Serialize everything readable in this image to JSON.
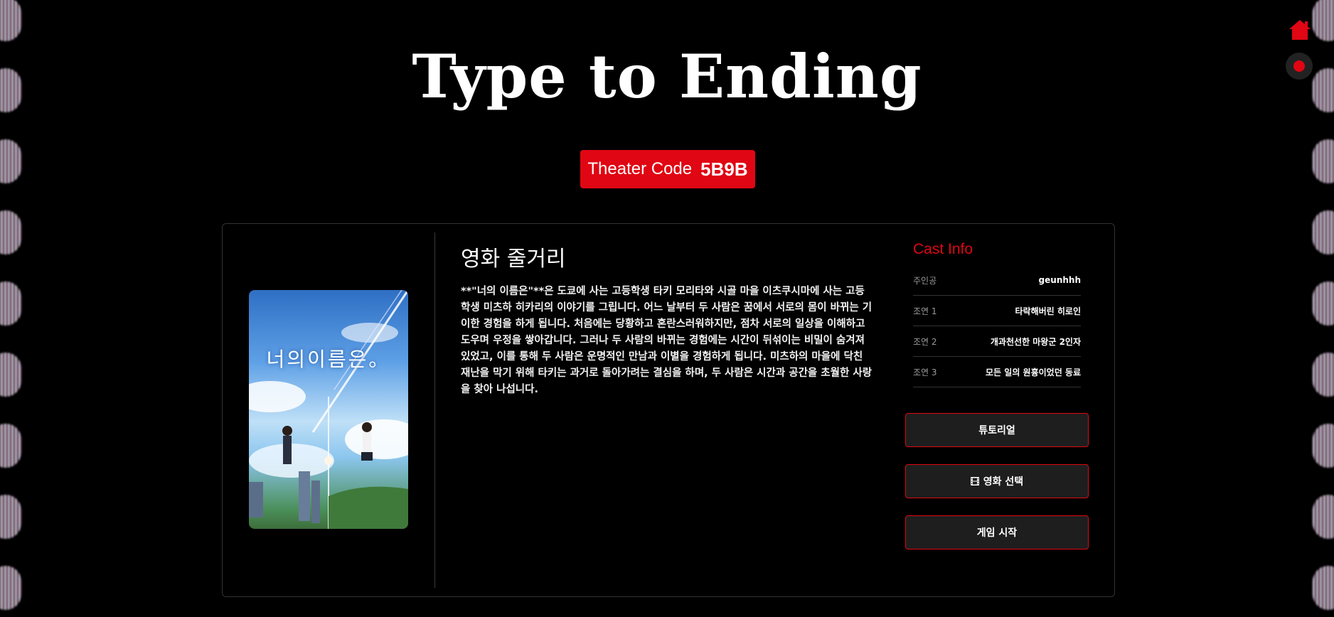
{
  "app": {
    "title": "Type to Ending",
    "accent_color": "#e00613"
  },
  "theater_code": {
    "label": "Theater Code",
    "value": "5B9B"
  },
  "top_right": {
    "home_icon": "home-icon",
    "record_icon": "record-icon"
  },
  "poster": {
    "title_text": "너의이름은。"
  },
  "synopsis": {
    "heading": "영화 줄거리",
    "body": "**\"너의 이름은\"**은 도쿄에 사는 고등학생 타키 모리타와 시골 마을 이츠쿠시마에 사는 고등학생 미츠하 히카리의 이야기를 그립니다. 어느 날부터 두 사람은 꿈에서 서로의 몸이 바뀌는 기이한 경험을 하게 됩니다. 처음에는 당황하고 혼란스러워하지만, 점차 서로의 일상을 이해하고 도우며 우정을 쌓아갑니다. 그러나 두 사람의 바뀌는 경험에는 시간이 뒤섞이는 비밀이 숨겨져 있었고, 이를 통해 두 사람은 운명적인 만남과 이별을 경험하게 됩니다. 미츠하의 마을에 닥친 재난을 막기 위해 타키는 과거로 돌아가려는 결심을 하며, 두 사람은 시간과 공간을 초월한 사랑을 찾아 나섭니다."
  },
  "cast": {
    "title": "Cast Info",
    "rows": [
      {
        "role": "주인공",
        "name": "geunhhh"
      },
      {
        "role": "조연 1",
        "name": "타락해버린 히로인"
      },
      {
        "role": "조연 2",
        "name": "개과천선한 마왕군 2인자"
      },
      {
        "role": "조연 3",
        "name": "모든 일의 원흉이었던 동료"
      }
    ]
  },
  "buttons": {
    "tutorial": "튜토리얼",
    "select_movie": "영화 선택",
    "select_movie_icon": "film-icon",
    "start_game": "게임 시작"
  }
}
